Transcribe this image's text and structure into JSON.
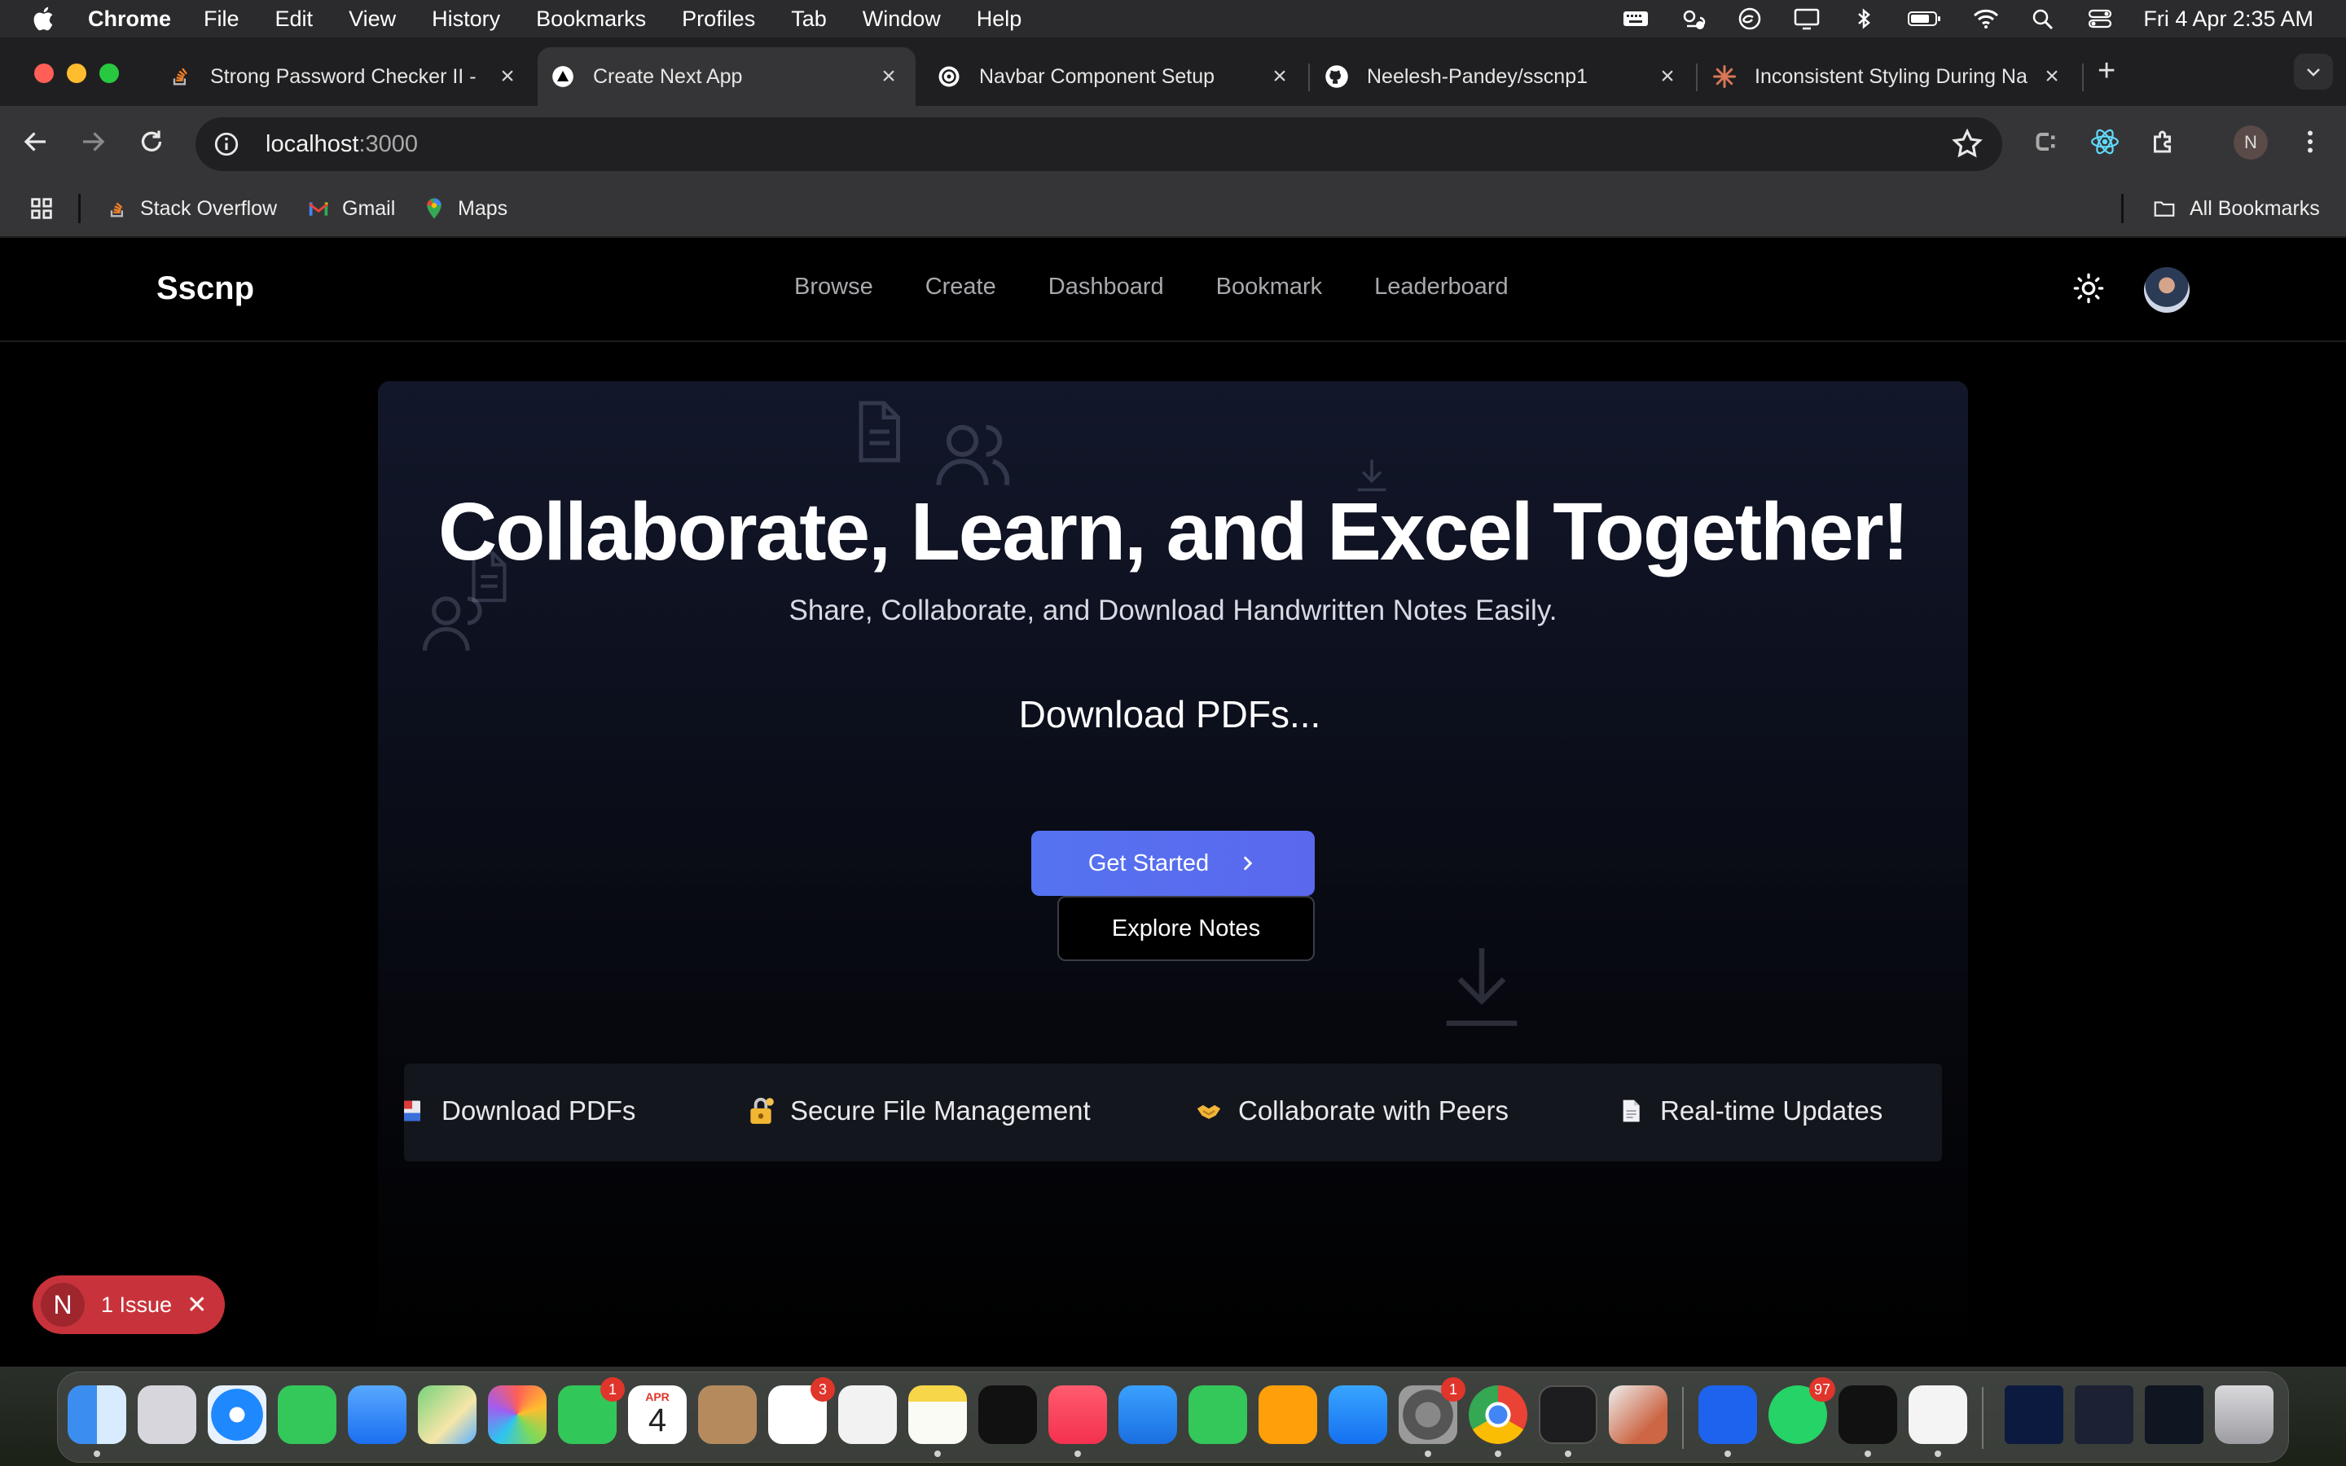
{
  "menubar": {
    "app": "Chrome",
    "items": [
      "File",
      "Edit",
      "View",
      "History",
      "Bookmarks",
      "Profiles",
      "Tab",
      "Window",
      "Help"
    ],
    "clock": "Fri 4 Apr  2:35 AM"
  },
  "tabs": [
    {
      "title": "Strong Password Checker II -",
      "favicon": "stackoverflow-icon"
    },
    {
      "title": "Create Next App",
      "favicon": "nextjs-icon"
    },
    {
      "title": "Navbar Component Setup",
      "favicon": "chatgpt-icon"
    },
    {
      "title": "Neelesh-Pandey/sscnp1",
      "favicon": "github-icon"
    },
    {
      "title": "Inconsistent Styling During Na",
      "favicon": "claude-icon"
    }
  ],
  "toolbar": {
    "url_host": "localhost",
    "url_port": ":3000",
    "profile_initial": "N"
  },
  "bookmarks": {
    "items": [
      "Stack Overflow",
      "Gmail",
      "Maps"
    ],
    "all": "All Bookmarks"
  },
  "site": {
    "brand": "Sscnp",
    "nav": [
      "Browse",
      "Create",
      "Dashboard",
      "Bookmark",
      "Leaderboard"
    ]
  },
  "hero": {
    "title": "Collaborate, Learn, and Excel Together!",
    "subtitle": "Share, Collaborate, and Download Handwritten Notes Easily.",
    "typing": "Download PDFs...",
    "primary_cta": "Get Started",
    "secondary_cta": "Explore Notes"
  },
  "features": [
    {
      "label": "Download PDFs",
      "icon": "pdf-icon"
    },
    {
      "label": "Secure File Management",
      "icon": "lock-icon"
    },
    {
      "label": "Collaborate with Peers",
      "icon": "handshake-icon"
    },
    {
      "label": "Real-time Updates",
      "icon": "document-icon"
    }
  ],
  "issues": {
    "initial": "N",
    "label": "1 Issue"
  },
  "dock": {
    "calendar_month": "APR",
    "calendar_day": "4",
    "badges": {
      "facetime": "1",
      "reminders": "3",
      "settings": "1",
      "whatsapp": "97"
    }
  },
  "colors": {
    "accent": "#5570f0",
    "page_bg": "#000000",
    "hero_bg": "#0c0f1c",
    "issue": "#c8333b"
  }
}
